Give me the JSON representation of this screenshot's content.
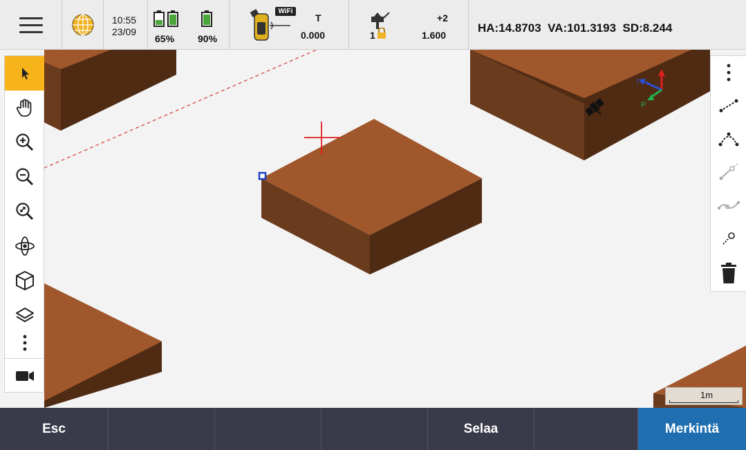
{
  "status": {
    "time": "10:55",
    "date": "23/09",
    "battery_a": "65%",
    "battery_b": "90%",
    "wifi_label": "WiFi",
    "target_label": "T",
    "target_value": "0.000",
    "prism_count": "1",
    "offset_label": "+2",
    "offset_value": "1.600",
    "readout": "HA:14.8703  VA:101.3193  SD:8.244"
  },
  "map": {
    "scale_label": "1m",
    "axis_labels": {
      "i": "I",
      "p": "P"
    }
  },
  "left_toolbar": {
    "tools": [
      "select-icon",
      "pan-hand-icon",
      "zoom-in-icon",
      "zoom-out-icon",
      "zoom-extents-icon",
      "orbit-icon",
      "view-cube-icon",
      "layers-icon",
      "more-icon",
      "camera-icon"
    ]
  },
  "right_toolbar": {
    "tools": [
      "more-icon",
      "line-icon",
      "arc-icon",
      "line-from-point-icon",
      "polyline-icon",
      "point-icon",
      "delete-icon"
    ]
  },
  "bottom_bar": {
    "esc": "Esc",
    "b2": "",
    "b3": "",
    "b4": "",
    "selaa": "Selaa",
    "b6": "",
    "merkinta": "Merkintä"
  },
  "colors": {
    "accent": "#f7b31a",
    "primary_button": "#1f6fb0",
    "bottom_bar": "#3a3b4a",
    "box_top": "#a0572b",
    "box_left": "#6b3b1d",
    "box_right": "#4f2b14"
  }
}
